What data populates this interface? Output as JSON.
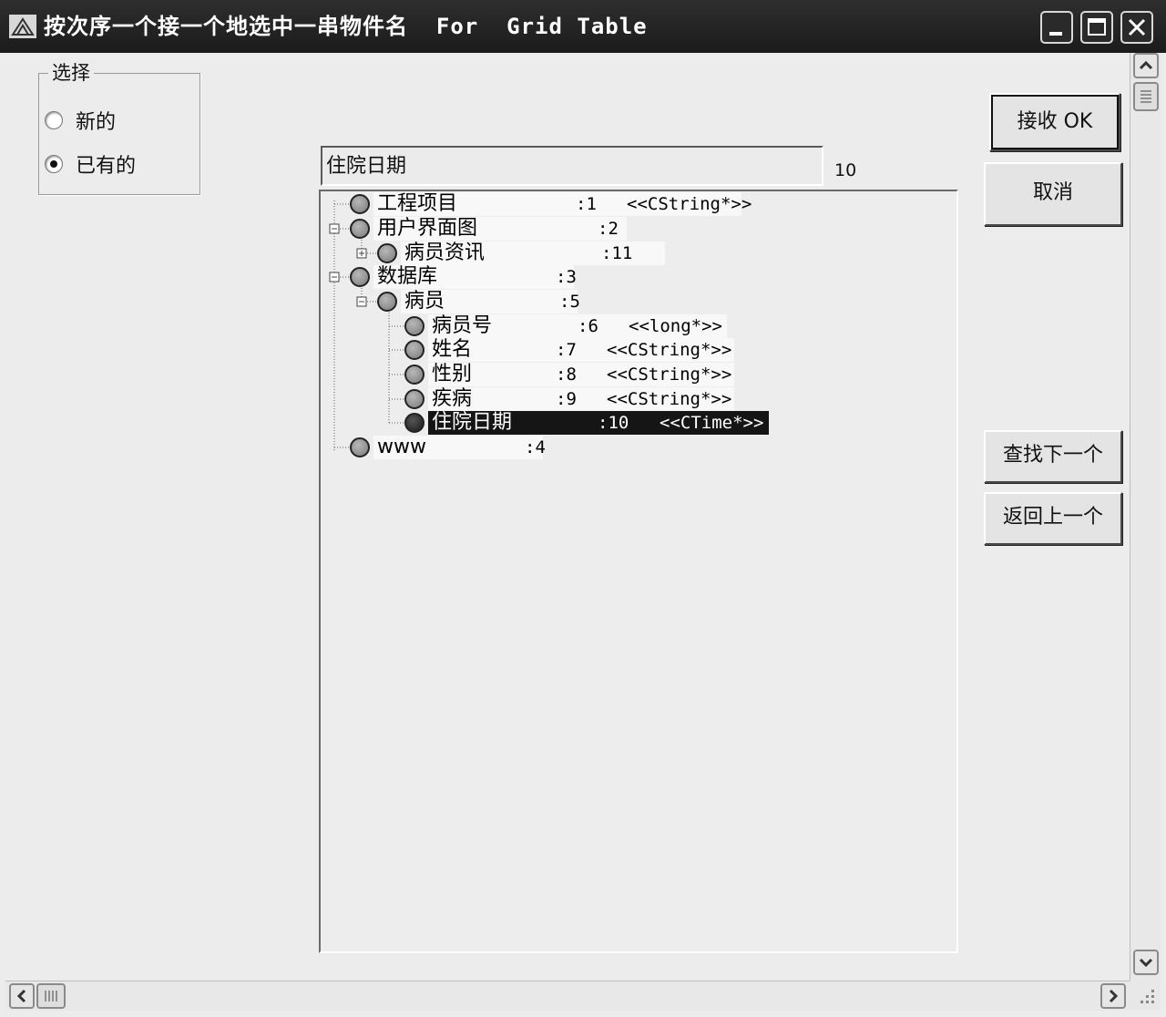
{
  "window": {
    "title": "按次序一个接一个地选中一串物件名  For  Grid Table"
  },
  "group": {
    "label": "选择",
    "options": [
      {
        "label": "新的",
        "selected": false
      },
      {
        "label": "已有的",
        "selected": true
      }
    ]
  },
  "edit": {
    "value": "住院日期",
    "count": "10"
  },
  "tree": {
    "nodes": [
      {
        "name": "工程项目",
        "num": ":1",
        "type": "<<CString*>>",
        "selected": false
      },
      {
        "name": "用户界面图",
        "num": ":2",
        "type": "",
        "selected": false
      },
      {
        "name": "病员资讯",
        "num": ":11",
        "type": "",
        "selected": false
      },
      {
        "name": "数据库",
        "num": ":3",
        "type": "",
        "selected": false
      },
      {
        "name": "病员",
        "num": ":5",
        "type": "",
        "selected": false
      },
      {
        "name": "病员号",
        "num": ":6",
        "type": "<<long*>>",
        "selected": false
      },
      {
        "name": "姓名",
        "num": ":7",
        "type": "<<CString*>>",
        "selected": false
      },
      {
        "name": "性别",
        "num": ":8",
        "type": "<<CString*>>",
        "selected": false
      },
      {
        "name": "疾病",
        "num": ":9",
        "type": "<<CString*>>",
        "selected": false
      },
      {
        "name": "住院日期",
        "num": ":10",
        "type": "<<CTime*>>",
        "selected": true
      },
      {
        "name": "www",
        "num": ":4",
        "type": "",
        "selected": false
      }
    ]
  },
  "buttons": {
    "ok": "接收 OK",
    "cancel": "取消",
    "find_next": "查找下一个",
    "go_back": "返回上一个"
  },
  "icons": {
    "app": "app-icon",
    "minimize": "minimize-icon",
    "maximize": "maximize-icon",
    "close": "close-icon"
  },
  "colors": {
    "titlebar": "#1f1f1f",
    "selection": "#151515",
    "window_bg": "#ececec"
  }
}
